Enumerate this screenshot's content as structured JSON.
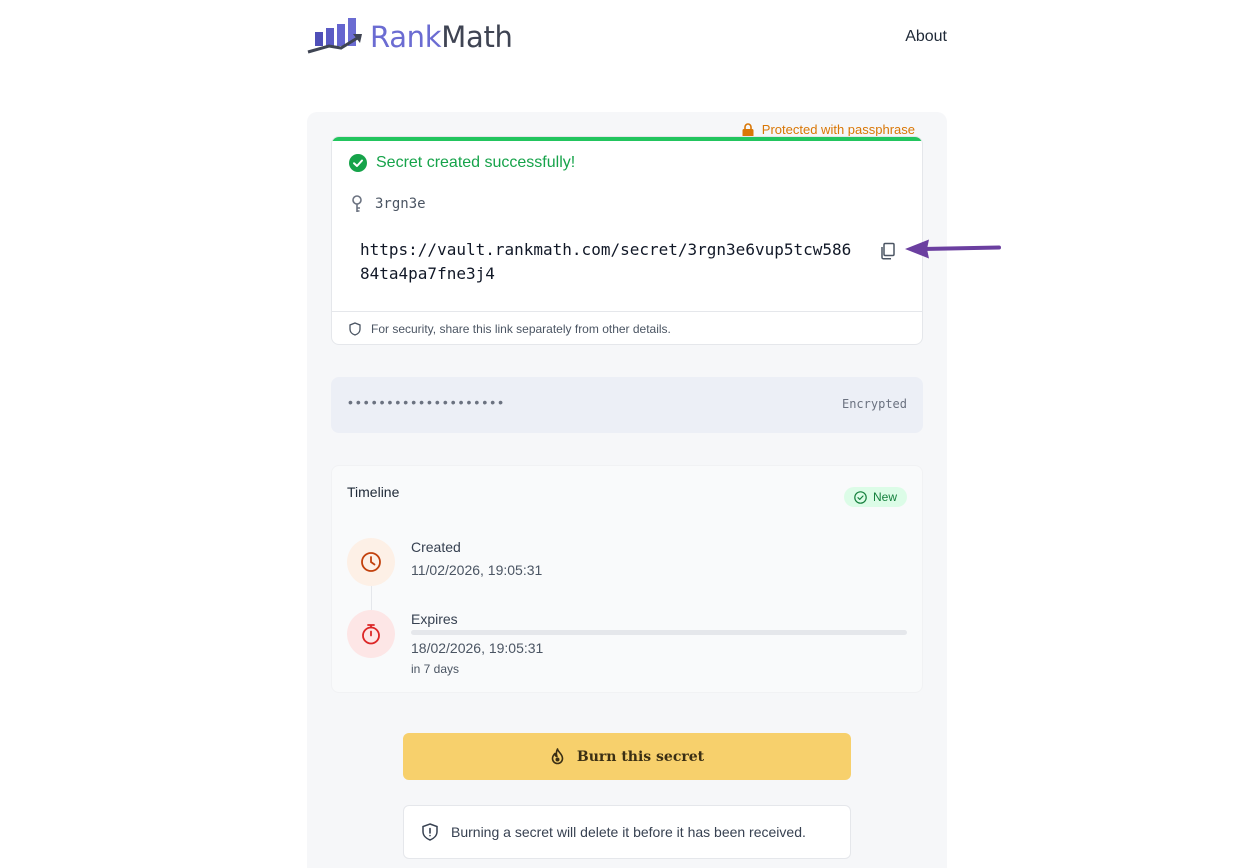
{
  "header": {
    "logo_rank": "Rank",
    "logo_math": "Math",
    "nav_about": "About"
  },
  "secret": {
    "passphrase_badge": "Protected with passphrase",
    "success_title": "Secret created successfully!",
    "secret_id": "3rgn3e",
    "link": "https://vault.rankmath.com/secret/3rgn3e6vup5tcw58684ta4pa7fne3j4",
    "security_note": "For security, share this link separately from other details."
  },
  "encrypted": {
    "masked_value": "••••••••••••••••••••",
    "label": "Encrypted"
  },
  "timeline": {
    "title": "Timeline",
    "status_badge": "New",
    "created_label": "Created",
    "created_date": "11/02/2026, 19:05:31",
    "expires_label": "Expires",
    "expires_date": "18/02/2026, 19:05:31",
    "expires_relative": "in 7 days",
    "expiry_progress_fraction": 0
  },
  "actions": {
    "burn_label": "Burn this secret",
    "burn_warning": "Burning a secret will delete it before it has been received."
  },
  "colors": {
    "brand": "#6b6cd2",
    "success": "#16a34a",
    "warning": "#d97706",
    "burn_button": "#f7d06c",
    "annotation_arrow": "#6b3fa0"
  }
}
